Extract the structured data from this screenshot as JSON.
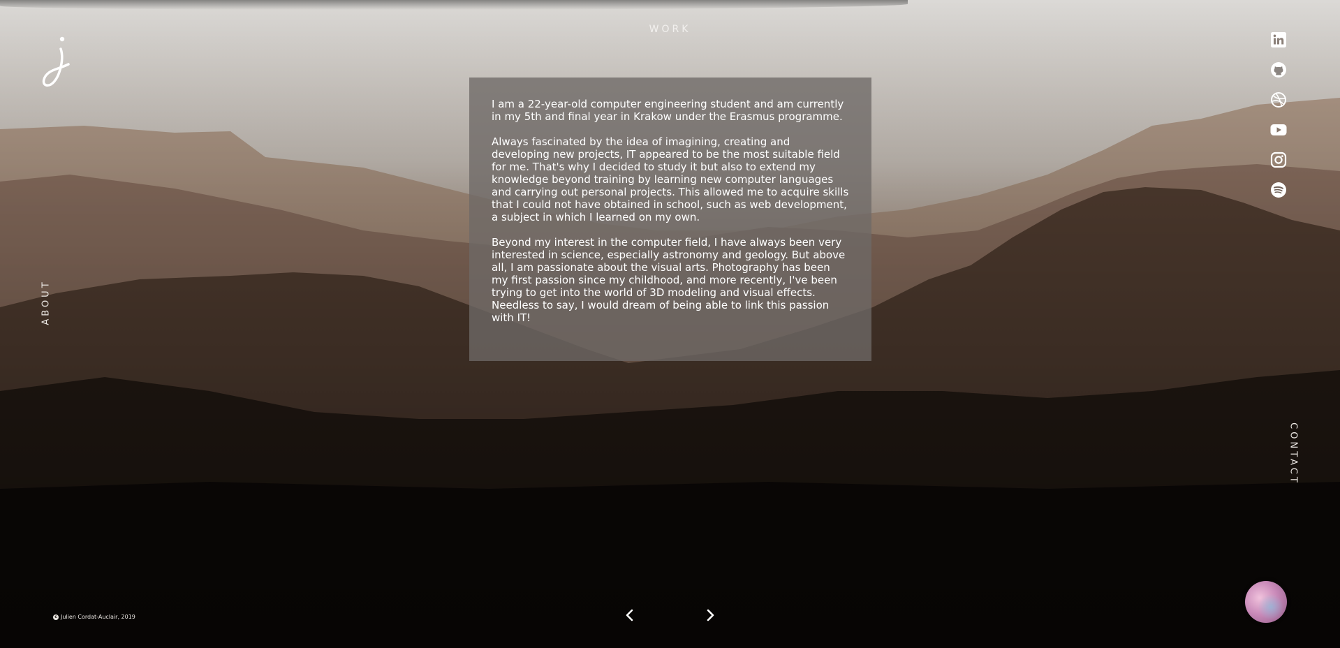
{
  "nav": {
    "work": "WORK",
    "about": "ABOUT",
    "contact": "CONTACT"
  },
  "logo": {
    "letter": "j"
  },
  "socials": [
    {
      "name": "linkedin",
      "icon": "linkedin-icon"
    },
    {
      "name": "github",
      "icon": "github-icon"
    },
    {
      "name": "dribbble",
      "icon": "dribbble-icon"
    },
    {
      "name": "youtube",
      "icon": "youtube-icon"
    },
    {
      "name": "instagram",
      "icon": "instagram-icon"
    },
    {
      "name": "spotify",
      "icon": "spotify-icon"
    }
  ],
  "about": {
    "paragraphs": [
      "I am a 22-year-old computer engineering student and am currently in my 5th and final year in Krakow under the Erasmus programme.",
      "Always fascinated by the idea of imagining, creating and developing new projects, IT appeared to be the most suitable field for me. That's why I decided to study it but also to extend my knowledge beyond training by learning new computer languages and carrying out personal projects. This allowed me to acquire skills that I could not have obtained in school, such as web development, a subject in which I learned on my own.",
      "Beyond my interest in the computer field, I have always been very interested in science, especially astronomy and geology. But above all, I am passionate about the visual arts. Photography has been my first passion since my childhood, and more recently, I've been trying to get into the world of 3D modeling and visual effects. Needless to say, I would dream of being able to link this passion with IT!"
    ]
  },
  "footer": {
    "copyright_symbol": "c",
    "copyright": "Julien Cordat-Auclair, 2019"
  },
  "colors": {
    "sky": "#d9d6d2",
    "mountain_far": "#9a7d66",
    "mountain_mid": "#5a4232",
    "ground": "#0e0a08",
    "card": "#6e6966"
  }
}
